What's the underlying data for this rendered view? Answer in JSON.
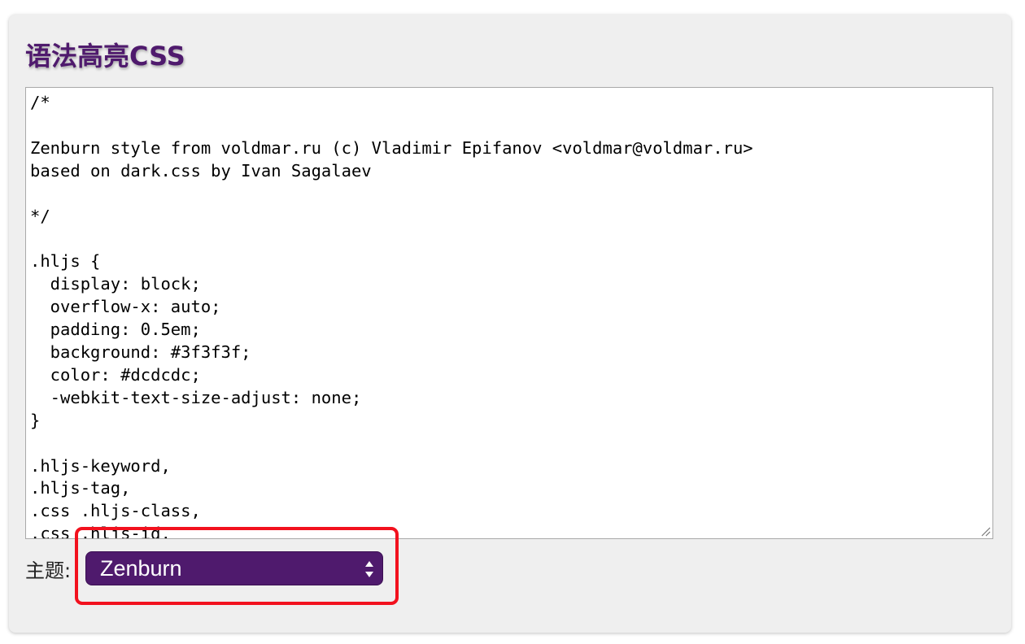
{
  "panel": {
    "title": "语法高亮CSS"
  },
  "editor": {
    "content": "/*\n\nZenburn style from voldmar.ru (c) Vladimir Epifanov <voldmar@voldmar.ru>\nbased on dark.css by Ivan Sagalaev\n\n*/\n\n.hljs {\n  display: block;\n  overflow-x: auto;\n  padding: 0.5em;\n  background: #3f3f3f;\n  color: #dcdcdc;\n  -webkit-text-size-adjust: none;\n}\n\n.hljs-keyword,\n.hljs-tag,\n.css .hljs-class,\n.css .hljs-id,"
  },
  "theme": {
    "label": "主题:",
    "selected": "Zenburn"
  },
  "colors": {
    "title": "#4f1a6d",
    "select_bg": "#4f1a6d",
    "highlight": "#f2111e",
    "panel_bg": "#efefef"
  },
  "icons": {
    "resize": "resize-grip-icon",
    "select": "select-arrows-icon"
  }
}
